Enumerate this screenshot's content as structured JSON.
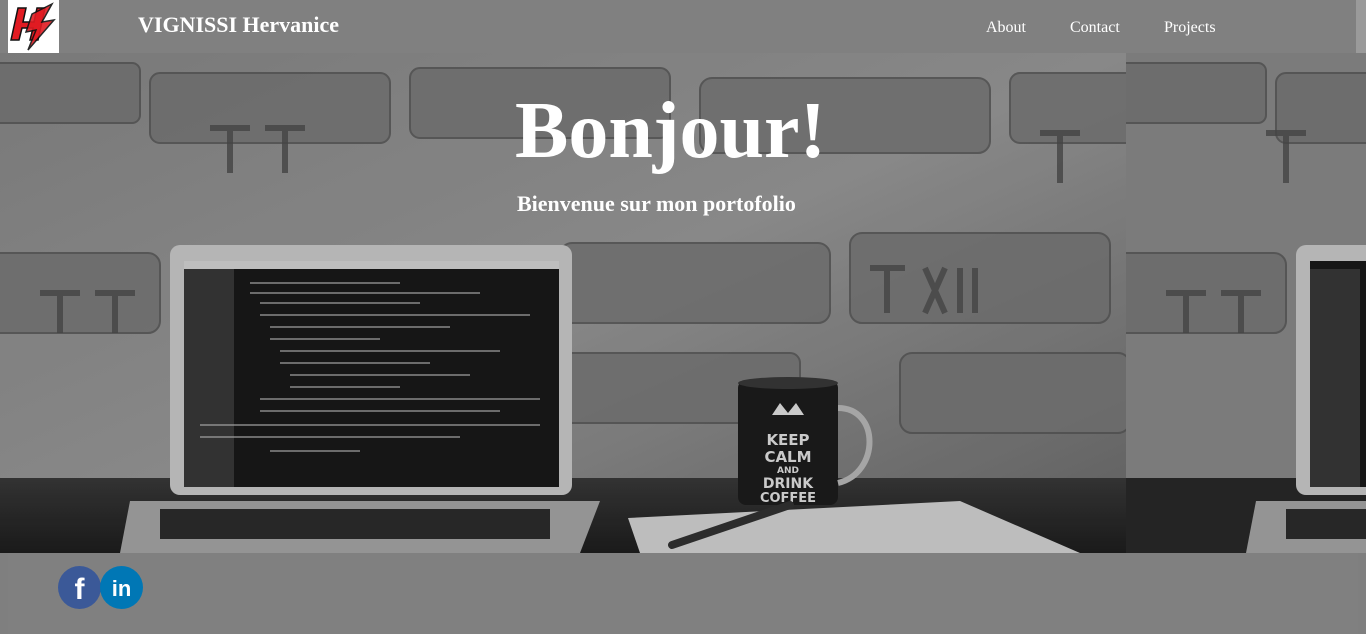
{
  "header": {
    "logo_icon": "h-lightning-logo-icon",
    "title": "VIGNISSI Hervanice",
    "nav": [
      {
        "label": "About"
      },
      {
        "label": "Contact"
      },
      {
        "label": "Projects"
      }
    ]
  },
  "hero": {
    "title": "Bonjour!",
    "subtitle": "Bienvenue sur mon portofolio",
    "background_image": "grayscale-laptop-coffee-mug-photo",
    "mug_text": "KEEP CALM AND DRINK COFFEE"
  },
  "footer": {
    "social": [
      {
        "icon": "facebook-icon",
        "glyph": "f",
        "color": "#3b5998"
      },
      {
        "icon": "linkedin-icon",
        "glyph": "in",
        "color": "#0077b5"
      }
    ]
  },
  "colors": {
    "header_bg": "#808080",
    "footer_bg": "#808080",
    "text": "#ffffff",
    "logo_red": "#e11b22"
  }
}
